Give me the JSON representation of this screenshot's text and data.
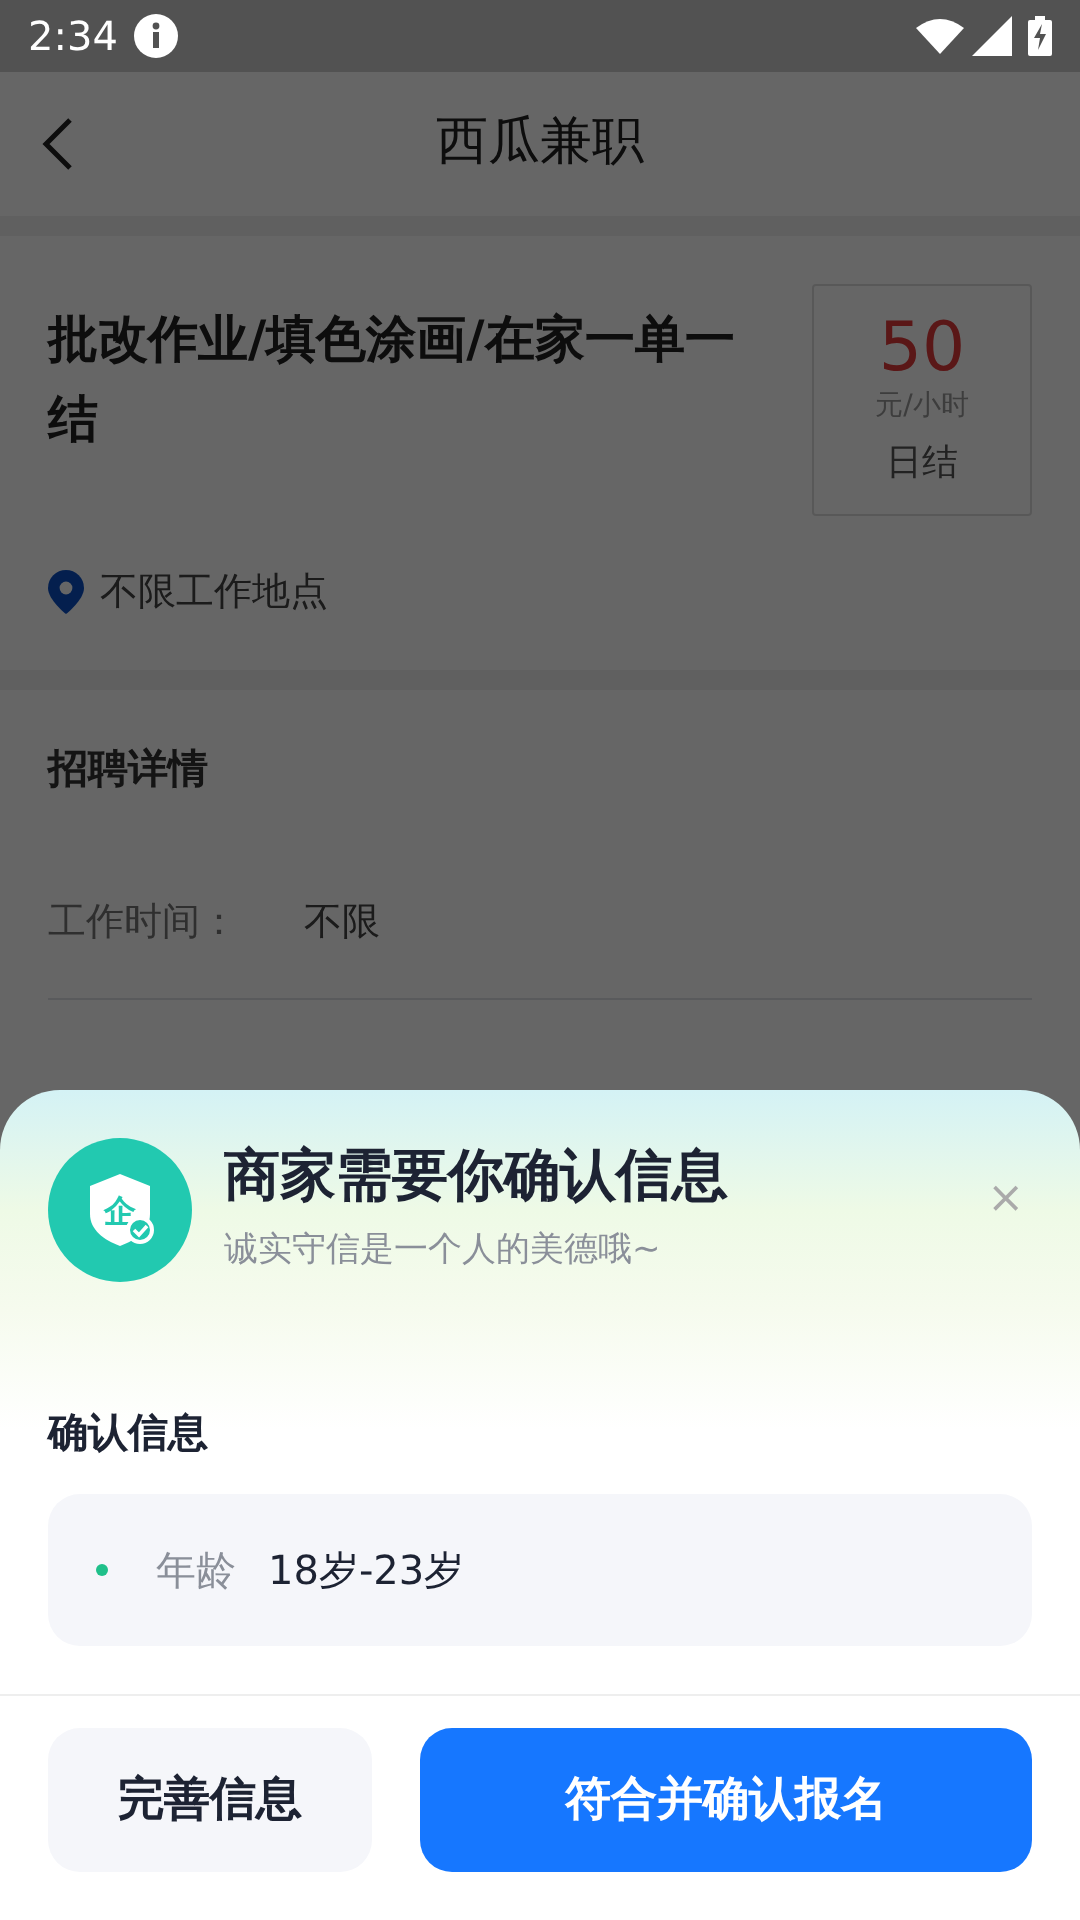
{
  "status_bar": {
    "time": "2:34"
  },
  "header": {
    "title": "西瓜兼职"
  },
  "job": {
    "title": "批改作业/填色涂画/在家一单一结",
    "pay": "50",
    "pay_unit": "元/小时",
    "settlement": "日结",
    "location": "不限工作地点"
  },
  "details": {
    "heading": "招聘详情",
    "rows": [
      {
        "label": "工作时间：",
        "value": "不限"
      }
    ]
  },
  "sheet": {
    "badge_glyph": "企",
    "title": "商家需要你确认信息",
    "subtitle": "诚实守信是一个人的美德哦~",
    "close": "×",
    "section": "确认信息",
    "items": [
      {
        "label": "年龄",
        "value": "18岁-23岁",
        "color": "#1fc08a"
      }
    ],
    "buttons": [
      {
        "label": "完善信息",
        "kind": "secondary"
      },
      {
        "label": "符合并确认报名",
        "kind": "primary"
      }
    ]
  }
}
